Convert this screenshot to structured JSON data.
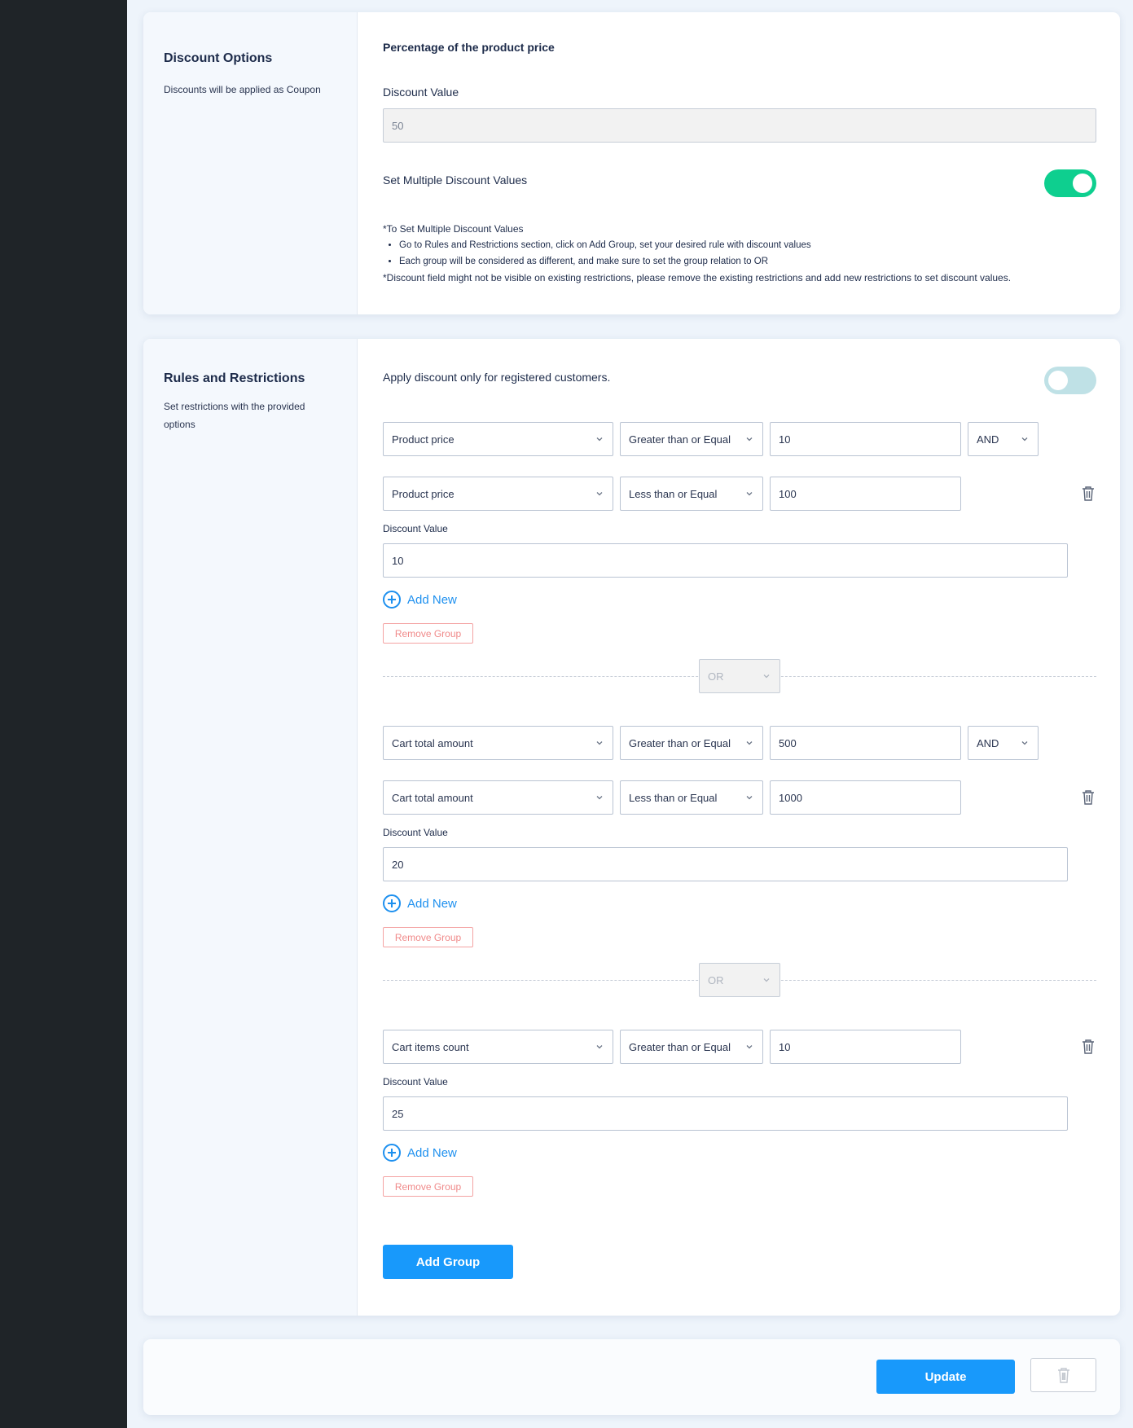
{
  "discount_options": {
    "title": "Discount Options",
    "subtitle": "Discounts will be applied as Coupon",
    "type_heading": "Percentage of the product price",
    "discount_value_label": "Discount Value",
    "discount_value": "50",
    "multiple_label": "Set Multiple Discount Values",
    "multiple_enabled": true,
    "note_heading": "*To Set Multiple Discount Values",
    "note_items": [
      "Go to Rules and Restrictions section, click on Add Group, set your desired rule with discount values",
      "Each group will be considered as different, and make sure to set the group relation to OR"
    ],
    "note_footer": "*Discount field might not be visible on existing restrictions, please remove the existing restrictions and add new restrictions to set discount values."
  },
  "rules": {
    "title": "Rules and Restrictions",
    "subtitle": "Set restrictions with the provided options",
    "registered_label": "Apply discount only for registered customers.",
    "registered_enabled": false,
    "discount_value_label": "Discount Value",
    "add_new_label": "Add New",
    "remove_group_label": "Remove Group",
    "group_relation": "OR",
    "add_group_label": "Add Group",
    "groups": [
      {
        "rows": [
          {
            "field": "Product price",
            "operator": "Greater than or Equal",
            "value": "10",
            "relation": "AND"
          },
          {
            "field": "Product price",
            "operator": "Less than or Equal",
            "value": "100"
          }
        ],
        "discount_value": "10"
      },
      {
        "rows": [
          {
            "field": "Cart total amount",
            "operator": "Greater than or Equal",
            "value": "500",
            "relation": "AND"
          },
          {
            "field": "Cart total amount",
            "operator": "Less than or Equal",
            "value": "1000"
          }
        ],
        "discount_value": "20"
      },
      {
        "rows": [
          {
            "field": "Cart items count",
            "operator": "Greater than or Equal",
            "value": "10"
          }
        ],
        "discount_value": "25"
      }
    ]
  },
  "footer": {
    "update_label": "Update"
  },
  "colors": {
    "primary": "#1899fb",
    "toggle_on": "#0ecf8f",
    "toggle_off": "#bfe1e6",
    "danger": "#f08a8a"
  }
}
